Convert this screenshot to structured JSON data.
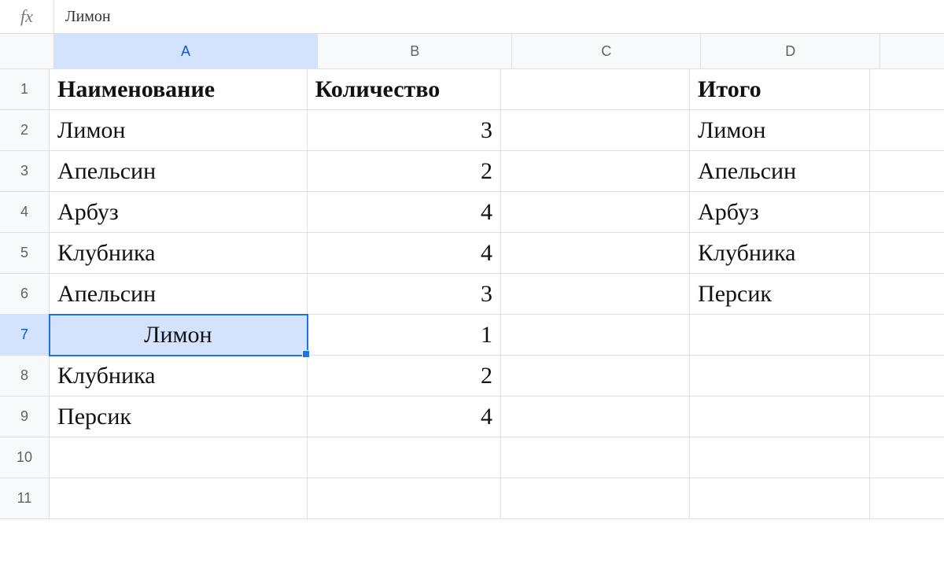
{
  "formula_bar": {
    "fx_label": "fx",
    "value": "Лимон"
  },
  "columns": [
    "A",
    "B",
    "C",
    "D",
    ""
  ],
  "active_column_index": 0,
  "active_row_index": 6,
  "rows": [
    {
      "num": "1",
      "A": "Наименование",
      "B": "Количество",
      "C": "",
      "D": "Итого",
      "header": true
    },
    {
      "num": "2",
      "A": "Лимон",
      "B": "3",
      "C": "",
      "D": "Лимон"
    },
    {
      "num": "3",
      "A": "Апельсин",
      "B": "2",
      "C": "",
      "D": "Апельсин"
    },
    {
      "num": "4",
      "A": "Арбуз",
      "B": "4",
      "C": "",
      "D": "Арбуз"
    },
    {
      "num": "5",
      "A": "Клубника",
      "B": "4",
      "C": "",
      "D": "Клубника"
    },
    {
      "num": "6",
      "A": "Апельсин",
      "B": "3",
      "C": "",
      "D": "Персик"
    },
    {
      "num": "7",
      "A": "Лимон",
      "B": "1",
      "C": "",
      "D": "",
      "selected": true
    },
    {
      "num": "8",
      "A": "Клубника",
      "B": "2",
      "C": "",
      "D": ""
    },
    {
      "num": "9",
      "A": "Персик",
      "B": "4",
      "C": "",
      "D": ""
    },
    {
      "num": "10",
      "A": "",
      "B": "",
      "C": "",
      "D": ""
    },
    {
      "num": "11",
      "A": "",
      "B": "",
      "C": "",
      "D": ""
    }
  ],
  "selected_cell": {
    "row": 7,
    "col": "A",
    "value": "Лимон"
  }
}
